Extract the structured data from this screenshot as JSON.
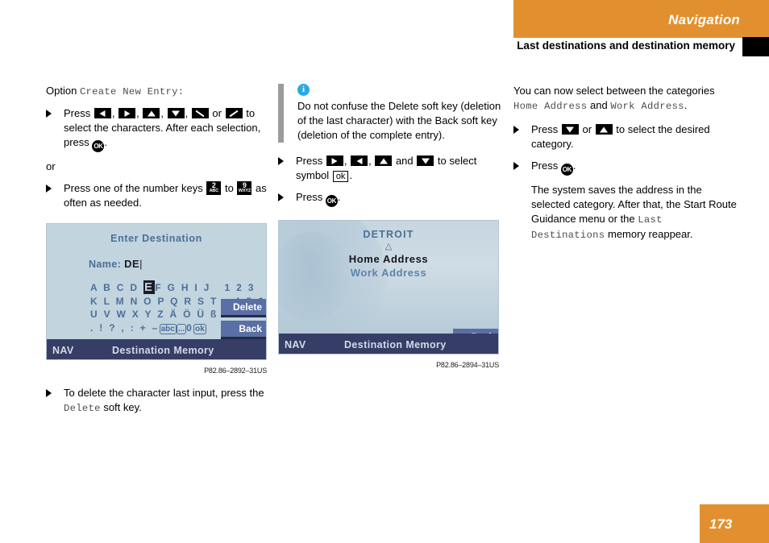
{
  "header": {
    "section_title": "Navigation",
    "subtitle": "Last destinations and destination memory",
    "accent_color": "#e2902f"
  },
  "columns": {
    "left": {
      "option_label": "Option",
      "option_value": "Create New Entry:",
      "step1_press": "Press",
      "step1_text": "to select the characters. After each selection, press",
      "step1_end": ".",
      "or_label": "or",
      "step2_pre": "Press one of the number keys",
      "step2_mid": "to",
      "step2_post": "as often as needed.",
      "keys_row": [
        "left-arrow-key",
        "right-arrow-key",
        "up-arrow-key",
        "down-arrow-key",
        "diag-down-key",
        "diag-up-key"
      ],
      "numkey_2": {
        "digit": "2",
        "letters": "ABC"
      },
      "numkey_9": {
        "digit": "9",
        "letters": "WXYZ"
      },
      "delete_step_pre": "To delete the character last input, press the",
      "delete_step_key": "Delete",
      "delete_step_post": "soft key."
    },
    "middle": {
      "note_text": "Do not confuse the Delete soft key (deletion of the last character) with the Back soft key (deletion of the complete entry).",
      "note_icon": "info-icon",
      "step1_pre": "Press",
      "step1_and": "and",
      "step1_mid": "to select symbol",
      "step1_symbol": "ok",
      "step1_end": ".",
      "step2_pre": "Press",
      "step2_end": "."
    },
    "right": {
      "intro_pre": "You can now select between the categories",
      "intro_cat1": "Home Address",
      "intro_and": "and",
      "intro_cat2": "Work Address",
      "intro_end": ".",
      "step1_pre": "Press",
      "step1_or": "or",
      "step1_post": "to select the desired category.",
      "step2_pre": "Press",
      "step2_end": ".",
      "result_pre": "The system saves the address in the selected category. After that, the Start Route Guidance menu or the",
      "result_mono": "Last Destinations",
      "result_post": "memory reappear."
    }
  },
  "screen1": {
    "title": "Enter Destination",
    "name_label": "Name:",
    "name_value": "DE",
    "caret": "|",
    "char_rows": [
      "A B C D E F G H I J   1 2 3",
      "K L M N O P Q R S T – 4 5 6",
      "U V W X Y Z Ä Ö Ü ß   7 8 9",
      ". ! ? , : + –"
    ],
    "selected_char": "E",
    "row1_before": "A B C D ",
    "row1_after": "F G H I J   1 2 3",
    "row4_boxed": [
      "abc",
      "...",
      "ok"
    ],
    "row4_zero": "0",
    "softkey_delete": "Delete",
    "softkey_back": "Back",
    "navbar_left": "NAV",
    "navbar_title": "Destination Memory",
    "caption": "P82.86–2892–31US"
  },
  "screen2": {
    "title": "DETROIT",
    "arrow_up": "△",
    "arrow_down": "▽",
    "item_selected": "Home Address",
    "item_other": "Work Address",
    "softkey_back": "Back",
    "navbar_left": "NAV",
    "navbar_title": "Destination Memory",
    "caption": "P82.86–2894–31US"
  },
  "footer": {
    "page_number": "173"
  }
}
